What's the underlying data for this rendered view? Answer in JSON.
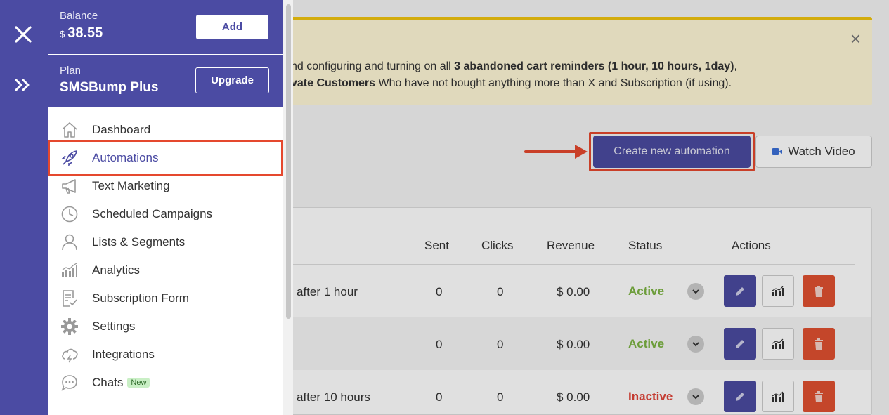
{
  "sidebar": {
    "balance_label": "Balance",
    "balance_currency": "$",
    "balance_amount": "38.55",
    "add_label": "Add",
    "plan_label": "Plan",
    "plan_name": "SMSBump Plus",
    "upgrade_label": "Upgrade",
    "items": [
      {
        "label": "Dashboard",
        "icon": "home-icon"
      },
      {
        "label": "Automations",
        "icon": "rocket-icon"
      },
      {
        "label": "Text Marketing",
        "icon": "megaphone-icon"
      },
      {
        "label": "Scheduled Campaigns",
        "icon": "clock-icon"
      },
      {
        "label": "Lists & Segments",
        "icon": "user-icon"
      },
      {
        "label": "Analytics",
        "icon": "bar-chart-icon"
      },
      {
        "label": "Subscription Form",
        "icon": "form-icon"
      },
      {
        "label": "Settings",
        "icon": "gear-icon"
      },
      {
        "label": "Integrations",
        "icon": "cloud-icon"
      },
      {
        "label": "Chats",
        "icon": "chat-icon",
        "badge": "New"
      }
    ]
  },
  "banner": {
    "line1_prefix": "nd configuring and turning on all ",
    "line1_bold": "3 abandoned cart reminders (1 hour, 10 hours, 1day)",
    "line1_suffix": ",",
    "line2_bold": "vate Customers",
    "line2_suffix": " Who have not bought anything more than X and Subscription (if using)."
  },
  "toolbar": {
    "create_label": "Create new automation",
    "video_label": "Watch Video"
  },
  "table": {
    "columns": [
      "Sent",
      "Clicks",
      "Revenue",
      "Status",
      "Actions"
    ],
    "rows": [
      {
        "name": "after 1 hour",
        "sent": "0",
        "clicks": "0",
        "revenue": "$ 0.00",
        "status": "Active"
      },
      {
        "name": "",
        "sent": "0",
        "clicks": "0",
        "revenue": "$ 0.00",
        "status": "Active"
      },
      {
        "name": "after 10 hours",
        "sent": "0",
        "clicks": "0",
        "revenue": "$ 0.00",
        "status": "Inactive"
      }
    ]
  },
  "colors": {
    "brand": "#4b4ba3",
    "highlight": "#e5482e",
    "active": "#7cb342",
    "inactive": "#e0453a",
    "delete": "#e05030"
  }
}
